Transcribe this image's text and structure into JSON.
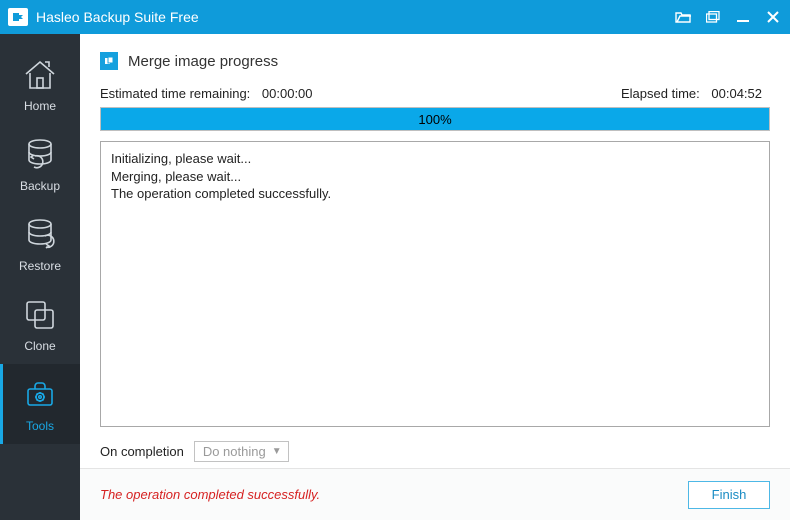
{
  "titlebar": {
    "title": "Hasleo Backup Suite Free"
  },
  "sidebar": {
    "items": [
      {
        "label": "Home"
      },
      {
        "label": "Backup"
      },
      {
        "label": "Restore"
      },
      {
        "label": "Clone"
      },
      {
        "label": "Tools"
      }
    ]
  },
  "page": {
    "title": "Merge image progress",
    "estimated_label": "Estimated time remaining:",
    "estimated_value": "00:00:00",
    "elapsed_label": "Elapsed time:",
    "elapsed_value": "00:04:52",
    "progress_percent": "100%",
    "log_lines": [
      "Initializing, please wait...",
      "Merging, please wait...",
      "The operation completed successfully."
    ],
    "on_completion_label": "On completion",
    "on_completion_selected": "Do nothing"
  },
  "footer": {
    "status": "The operation completed successfully.",
    "finish_label": "Finish"
  }
}
